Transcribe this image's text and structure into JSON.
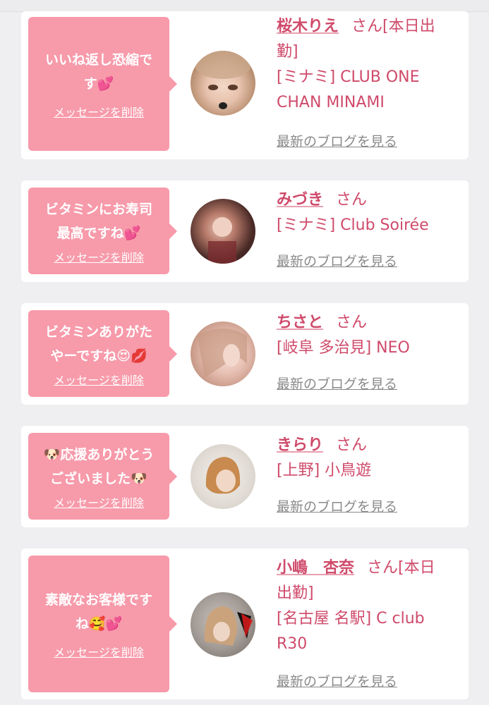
{
  "cards": [
    {
      "message_lines": [
        "いいね返し恐縮で",
        "す💕"
      ],
      "delete_label": "メッセージを削除",
      "name": "桜木りえ",
      "san": "さん",
      "status": "[本日出",
      "status2": "勤]",
      "shop_lines": [
        "[ミナミ] CLUB ONE",
        "CHAN MINAMI"
      ],
      "blog_label": "最新のブログを見る"
    },
    {
      "message_lines": [
        "ビタミンにお寿司",
        "最高ですね💕"
      ],
      "delete_label": "メッセージを削除",
      "name": "みづき",
      "san": "さん",
      "shop_lines": [
        "[ミナミ] Club Soirée"
      ],
      "blog_label": "最新のブログを見る"
    },
    {
      "message_lines": [
        "ビタミンありがた",
        "やーですね😍💋"
      ],
      "delete_label": "メッセージを削除",
      "name": "ちさと",
      "san": "さん",
      "shop_lines": [
        "[岐阜 多治見] NEO"
      ],
      "blog_label": "最新のブログを見る"
    },
    {
      "message_lines": [
        "🐶応援ありがとう",
        "ございました🐶"
      ],
      "delete_label": "メッセージを削除",
      "name": "きらり",
      "san": "さん",
      "shop_lines": [
        "[上野] 小鳥遊"
      ],
      "blog_label": "最新のブログを見る"
    },
    {
      "message_lines": [
        "素敵なお客様です",
        "ね🥰💕"
      ],
      "delete_label": "メッセージを削除",
      "name": "小嶋　杏奈",
      "san": "さん",
      "status": "[本日",
      "status2": "出勤]",
      "shop_lines": [
        "[名古屋 名駅] C club",
        "R30"
      ],
      "blog_label": "最新のブログを見る"
    }
  ],
  "colors": {
    "pink": "#f79aaa",
    "text": "#cf4a6a",
    "gray": "#8a8a8a"
  }
}
